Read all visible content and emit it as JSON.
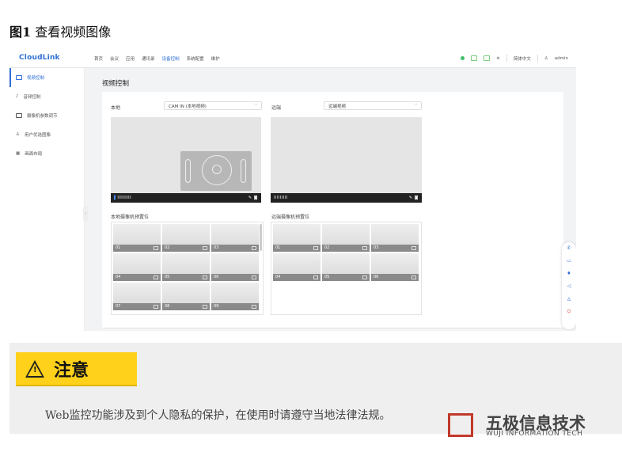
{
  "figure": {
    "prefix": "图1",
    "title": "查看视频图像"
  },
  "app": {
    "logo": "CloudLink",
    "nav": [
      "首页",
      "会议",
      "应用",
      "通讯录",
      "设备控制",
      "系统配置",
      "维护"
    ],
    "active_nav": "设备控制",
    "language": "简体中文",
    "user": "admin"
  },
  "sidebar": {
    "items": [
      {
        "label": "视频控制",
        "icon": "camera-icon",
        "active": true
      },
      {
        "label": "音频控制",
        "icon": "mic-icon",
        "active": false
      },
      {
        "label": "摄像机参数调节",
        "icon": "camera-settings-icon",
        "active": false
      },
      {
        "label": "用户优选图像",
        "icon": "user-icon",
        "active": false
      },
      {
        "label": "画面布局",
        "icon": "layout-icon",
        "active": false
      }
    ]
  },
  "main": {
    "title": "视频控制",
    "local": {
      "label": "本地",
      "select_value": "CAM IN (本地视频)",
      "bar": "IIIIIIIII"
    },
    "remote": {
      "label": "远端",
      "select_value": "远端视频",
      "bar": "IIIIIIIII"
    },
    "local_presets_title": "本地摄像机预置位",
    "remote_presets_title": "远端摄像机预置位",
    "local_presets": [
      "01",
      "02",
      "03",
      "04",
      "05",
      "06",
      "07",
      "08",
      "09"
    ],
    "remote_presets": [
      "01",
      "02",
      "03",
      "04",
      "05",
      "06"
    ]
  },
  "floating_toolbar": [
    "phone-icon",
    "monitor-icon",
    "mic-icon",
    "speaker-icon",
    "bell-icon",
    "power-icon"
  ],
  "notice": {
    "badge": "注意",
    "text": "Web监控功能涉及到个人隐私的保护，在使用时请遵守当地法律法规。"
  },
  "watermark": {
    "title": "五极信息技术",
    "subtitle": "WUJI INFORMATION TECH"
  },
  "colors": {
    "accent": "#2f6fd6",
    "warning": "#ffd11a",
    "watermark": "#c0392b"
  }
}
